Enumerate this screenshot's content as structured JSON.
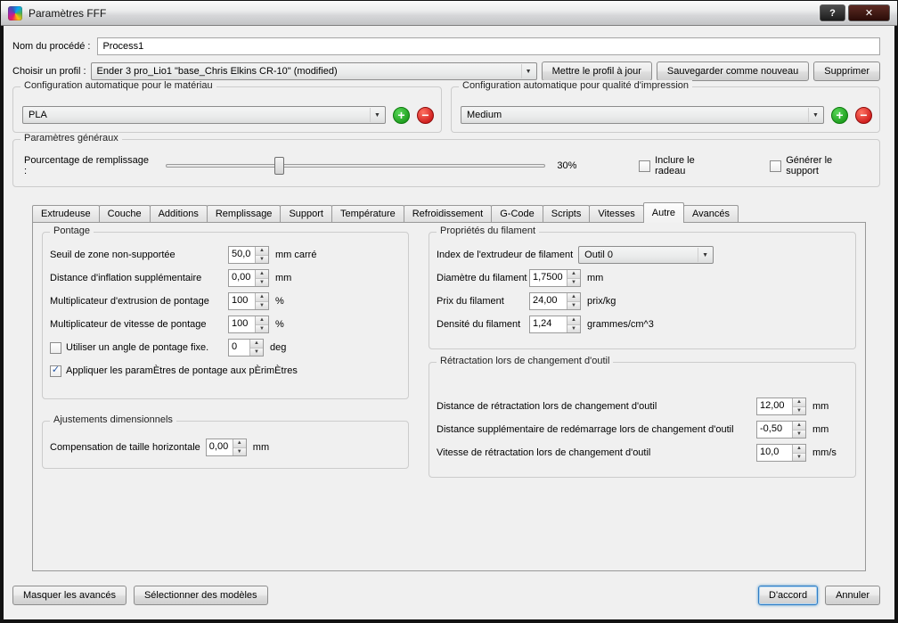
{
  "window": {
    "title": "Paramètres FFF",
    "controls": {
      "help": "?",
      "close": "✕"
    }
  },
  "icons": {
    "dropdown_arrow": "▼",
    "spin_up": "▲",
    "spin_down": "▼",
    "check": "✓",
    "add": "+",
    "remove": "−"
  },
  "header": {
    "process_name": {
      "label": "Nom du procédé :",
      "value": "Process1"
    },
    "profile": {
      "label": "Choisir un profil :",
      "value": "Ender 3 pro_Lio1 \"base_Chris Elkins CR-10\" (modified)"
    },
    "buttons": {
      "update": "Mettre le profil à jour",
      "save_new": "Sauvegarder comme nouveau",
      "delete": "Supprimer"
    }
  },
  "auto_material": {
    "title": "Configuration automatique pour le matériau",
    "value": "PLA"
  },
  "auto_quality": {
    "title": "Configuration automatique pour qualité d'impression",
    "value": "Medium"
  },
  "general": {
    "title": "Paramètres généraux",
    "infill": {
      "label": "Pourcentage de remplissage :",
      "percent": 30,
      "display": "30%"
    },
    "raft": {
      "label": "Inclure le radeau",
      "checked": false
    },
    "support": {
      "label": "Générer le support",
      "checked": false
    }
  },
  "tabs": {
    "items": [
      "Extrudeuse",
      "Couche",
      "Additions",
      "Remplissage",
      "Support",
      "Température",
      "Refroidissement",
      "G-Code",
      "Scripts",
      "Vitesses",
      "Autre",
      "Avancés"
    ],
    "selected": "Autre"
  },
  "bridging": {
    "title": "Pontage",
    "rows": [
      {
        "label": "Seuil de zone non-supportée",
        "value": "50,0",
        "unit": "mm carré"
      },
      {
        "label": "Distance d'inflation supplémentaire",
        "value": "0,00",
        "unit": "mm"
      },
      {
        "label": "Multiplicateur d'extrusion de pontage",
        "value": "100",
        "unit": "%"
      },
      {
        "label": "Multiplicateur de vitesse de pontage",
        "value": "100",
        "unit": "%"
      }
    ],
    "fixed_angle": {
      "label": "Utiliser un angle de pontage fixe.",
      "checked": false,
      "value": "0",
      "unit": "deg"
    },
    "apply_perimeters": {
      "label": "Appliquer les paramÈtres de pontage aux pÈrimÈtres",
      "checked": true
    }
  },
  "dimensional": {
    "title": "Ajustements dimensionnels",
    "row": {
      "label": "Compensation de taille horizontale",
      "value": "0,00",
      "unit": "mm"
    }
  },
  "filament": {
    "title": "Propriétés du filament",
    "toolhead": {
      "label": "Index de l'extrudeur de filament",
      "value": "Outil 0"
    },
    "rows": [
      {
        "label": "Diamètre du filament",
        "value": "1,7500",
        "unit": "mm"
      },
      {
        "label": "Prix du filament",
        "value": "24,00",
        "unit": "prix/kg"
      },
      {
        "label": "Densité du filament",
        "value": "1,24",
        "unit": "grammes/cm^3"
      }
    ]
  },
  "toolchange": {
    "title": "Rétractation lors de changement d'outil",
    "rows": [
      {
        "label": "Distance de rétractation lors de changement d'outil",
        "value": "12,00",
        "unit": "mm"
      },
      {
        "label": "Distance supplémentaire de redémarrage lors de changement d'outil",
        "value": "-0,50",
        "unit": "mm"
      },
      {
        "label": "Vitesse de rétractation lors de changement d'outil",
        "value": "10,0",
        "unit": "mm/s"
      }
    ]
  },
  "footer": {
    "hide_advanced": "Masquer les avancés",
    "select_models": "Sélectionner des modèles",
    "ok": "D'accord",
    "cancel": "Annuler"
  }
}
